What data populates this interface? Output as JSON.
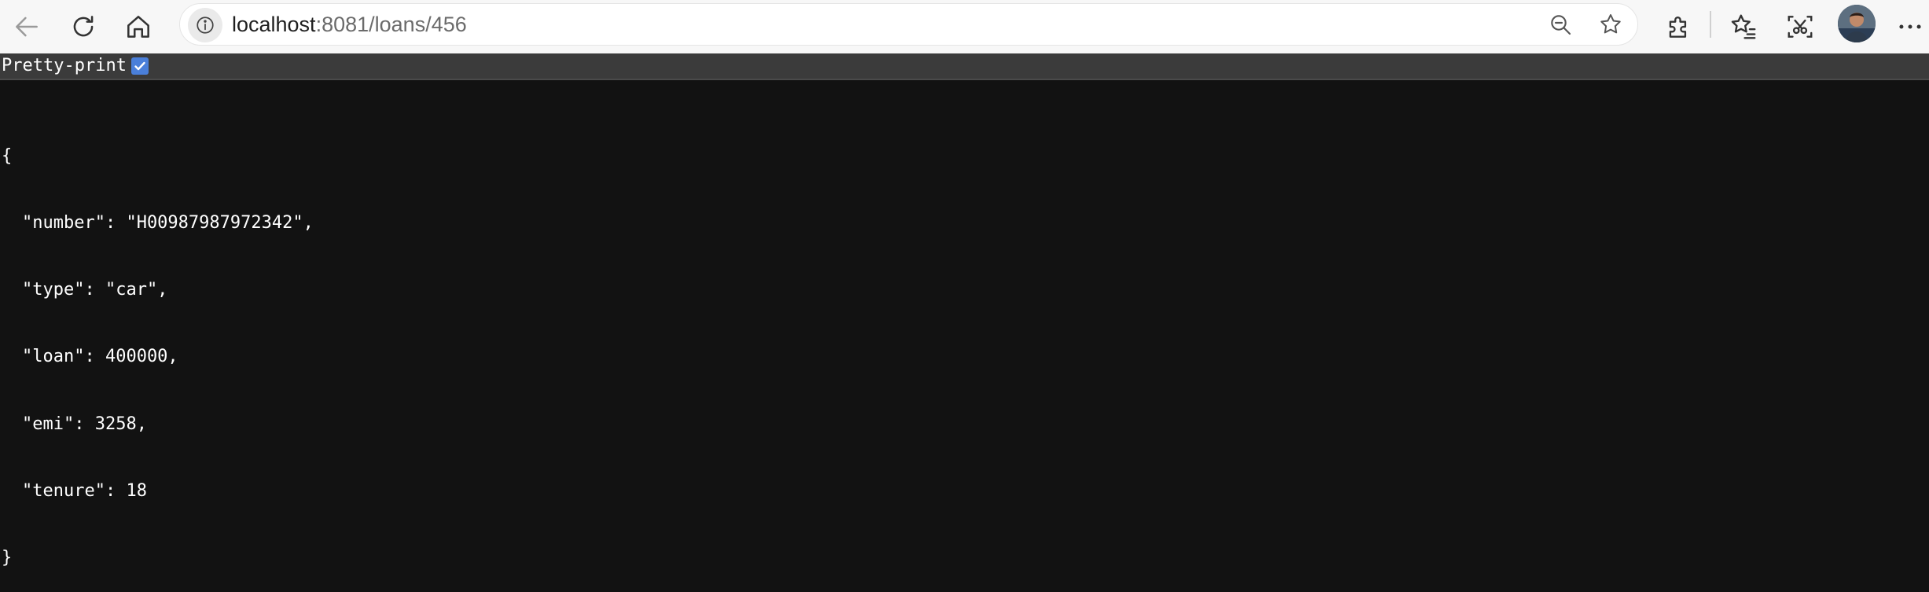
{
  "browser": {
    "url_host": "localhost",
    "url_path": ":8081/loans/456",
    "icons": {
      "back": "back-arrow-icon",
      "refresh": "refresh-icon",
      "home": "home-icon",
      "site_info": "info-icon",
      "zoom": "zoom-out-icon",
      "favorite": "star-icon",
      "extensions": "puzzle-icon",
      "favorites": "favorites-icon",
      "screenshot": "screenshot-icon",
      "menu": "more-icon"
    }
  },
  "viewer": {
    "pretty_print_label": "Pretty-print",
    "pretty_print_checked": true
  },
  "json_lines": {
    "open": "{",
    "number": "\"number\": \"H00987987972342\",",
    "type": "\"type\": \"car\",",
    "loan": "\"loan\": 400000,",
    "emi": "\"emi\": 3258,",
    "tenure": "\"tenure\": 18",
    "close": "}"
  },
  "colors": {
    "toolbar_bg": "#f7f7f7",
    "page_bg": "#121212",
    "pretty_bar_bg": "#3b3b3b",
    "checkbox": "#4a7fd9"
  }
}
